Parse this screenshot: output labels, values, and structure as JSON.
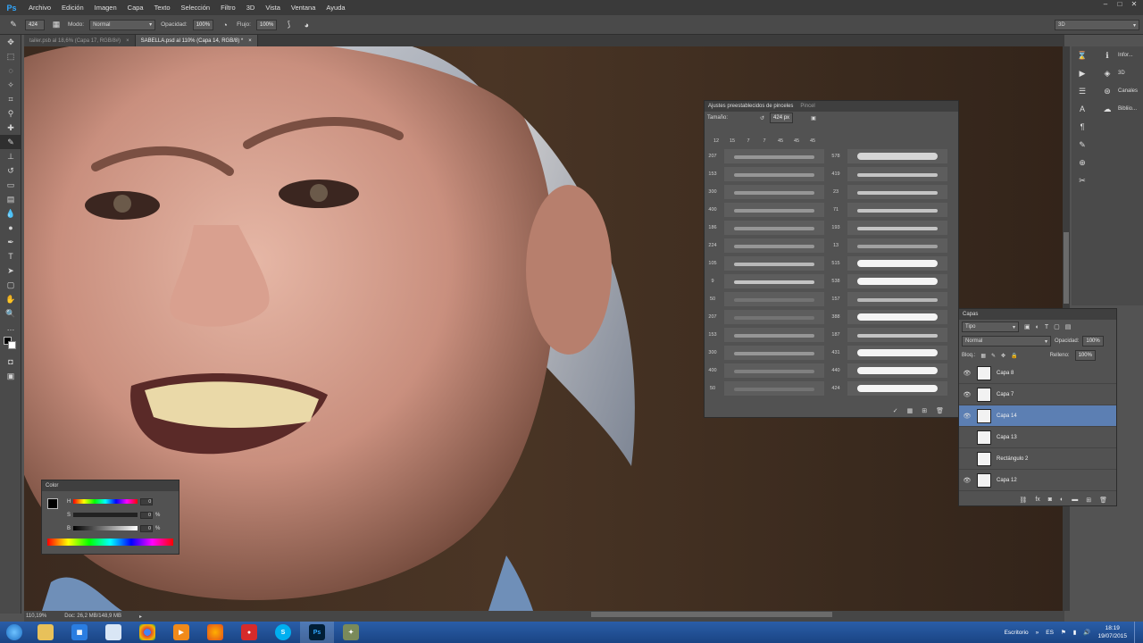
{
  "menubar": {
    "logo": "Ps",
    "items": [
      "Archivo",
      "Edición",
      "Imagen",
      "Capa",
      "Texto",
      "Selección",
      "Filtro",
      "3D",
      "Vista",
      "Ventana",
      "Ayuda"
    ]
  },
  "options": {
    "brush_size": "424",
    "mode_label": "Modo:",
    "mode_value": "Normal",
    "opacity_label": "Opacidad:",
    "opacity_value": "100%",
    "flow_label": "Flujo:",
    "flow_value": "100%",
    "workspace": "3D"
  },
  "tabs": [
    {
      "label": "tailer.psb al 18,6% (Capa 17, RGB/8#)",
      "close": "×"
    },
    {
      "label": "SABELLA.psd al 110% (Capa 14, RGB/8) *",
      "close": "×"
    }
  ],
  "status": {
    "zoom": "110,19%",
    "doc": "Doc: 26,2 MB/148,9 MB"
  },
  "dock": {
    "labels": [
      "Infor...",
      "3D",
      "Canales",
      "Bibliio..."
    ]
  },
  "brush_panel": {
    "tab_active": "Ajustes preestablecidos de pinceles",
    "tab_inactive": "Pincel",
    "size_label": "Tamaño:",
    "size_value": "424 px",
    "top_sizes": [
      "12",
      "15",
      "7",
      "7",
      "45",
      "45",
      "45"
    ],
    "left_nums": [
      "207",
      "153",
      "300",
      "400",
      "186",
      "224",
      "105",
      "9",
      "50",
      "207",
      "153",
      "300",
      "400",
      "50"
    ],
    "right_nums": [
      "578",
      "419",
      "23",
      "71",
      "193",
      "13",
      "515",
      "538",
      "157",
      "388",
      "187",
      "431",
      "440",
      "424"
    ]
  },
  "layers": {
    "title": "Capas",
    "filter": "Tipo",
    "blend": "Normal",
    "opacity_label": "Opacidad:",
    "opacity_value": "100%",
    "lock_label": "Bloq.:",
    "fill_label": "Relleno:",
    "fill_value": "100%",
    "items": [
      {
        "name": "Capa 8",
        "visible": true,
        "selected": false
      },
      {
        "name": "Capa 7",
        "visible": true,
        "selected": false
      },
      {
        "name": "Capa 14",
        "visible": true,
        "selected": true
      },
      {
        "name": "Capa 13",
        "visible": false,
        "selected": false
      },
      {
        "name": "Rectángulo 2",
        "visible": false,
        "selected": false
      },
      {
        "name": "Capa 12",
        "visible": true,
        "selected": false
      }
    ]
  },
  "color_panel": {
    "title": "Color",
    "h_label": "H",
    "h_value": "0",
    "s_label": "S",
    "s_value": "0",
    "s_unit": "%",
    "b_label": "B",
    "b_value": "0",
    "b_unit": "%"
  },
  "taskbar": {
    "desktop": "Escritorio",
    "lang": "ES",
    "time": "18:19",
    "date": "19/07/2015"
  },
  "colors": {
    "accent": "#31a8ff",
    "selected_layer": "#5c7fb3"
  }
}
